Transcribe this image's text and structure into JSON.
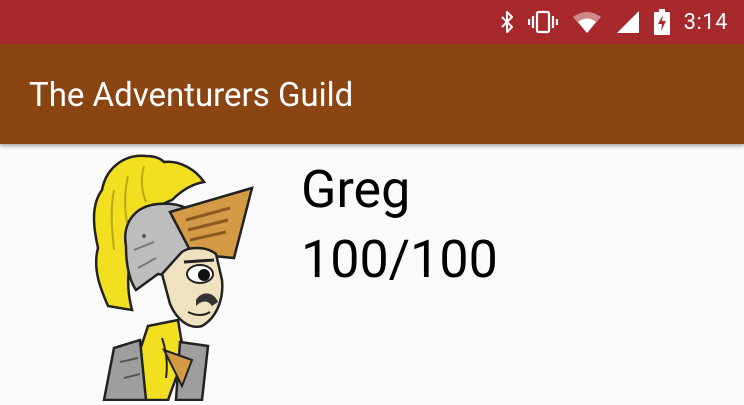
{
  "status_bar": {
    "time": "3:14",
    "icons": [
      "bluetooth-icon",
      "vibrate-icon",
      "wifi-icon",
      "cell-signal-icon",
      "battery-charging-icon"
    ],
    "color": "#a8292c"
  },
  "app_bar": {
    "title": "The Adventurers Guild",
    "color": "#8b4513"
  },
  "character": {
    "name": "Greg",
    "hp": "100/100",
    "avatar_icon": "knight-avatar"
  }
}
